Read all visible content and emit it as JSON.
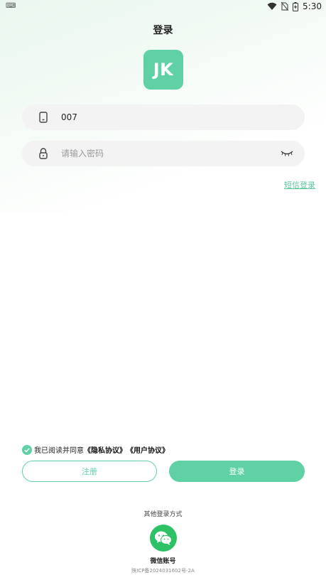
{
  "status_bar": {
    "left_text": "⌨",
    "time": "5:30",
    "icons": [
      "wifi-icon",
      "no-sim-icon",
      "battery-charging-icon"
    ]
  },
  "header": {
    "title": "登录"
  },
  "logo": {
    "text": "JK",
    "color": "#5fd1a4"
  },
  "form": {
    "phone_value": "007",
    "password_placeholder": "请输入密码",
    "sms_login": "短信登录"
  },
  "agreement": {
    "prefix": "我已阅读并同意",
    "privacy": "《隐私协议》",
    "user": "《用户协议》",
    "checked": true
  },
  "buttons": {
    "register": "注册",
    "login": "登录"
  },
  "other_login": {
    "title": "其他登录方式",
    "wechat_label": "微信账号"
  },
  "footer": {
    "icp": "陕ICP备2024031602号-2A"
  },
  "colors": {
    "accent": "#5fd1a4",
    "wechat": "#2cc265"
  }
}
